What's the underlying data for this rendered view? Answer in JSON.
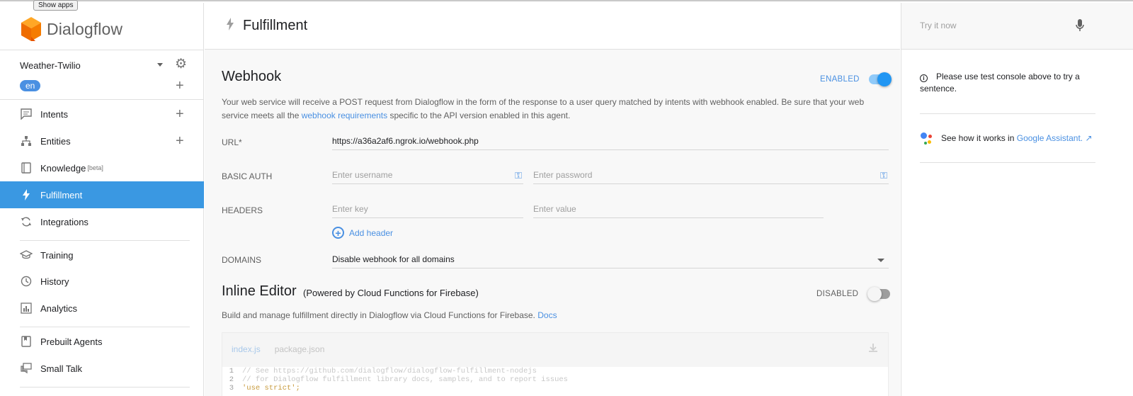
{
  "tooltip": "Show apps",
  "app": {
    "brand": "Dialogflow"
  },
  "agent": {
    "name": "Weather-Twilio",
    "language": "en"
  },
  "nav": [
    {
      "label": "Intents",
      "icon": "chat-icon"
    },
    {
      "label": "Entities",
      "icon": "hierarchy-icon"
    },
    {
      "label": "Knowledge",
      "badge": "[beta]",
      "icon": "book-icon"
    },
    {
      "label": "Fulfillment",
      "icon": "bolt-icon"
    },
    {
      "label": "Integrations",
      "icon": "sync-icon"
    },
    {
      "label": "Training",
      "icon": "graduation-cap-icon"
    },
    {
      "label": "History",
      "icon": "clock-icon"
    },
    {
      "label": "Analytics",
      "icon": "bar-chart-icon"
    },
    {
      "label": "Prebuilt Agents",
      "icon": "bookmark-book-icon"
    },
    {
      "label": "Small Talk",
      "icon": "speech-bubbles-icon"
    }
  ],
  "page": {
    "title": "Fulfillment"
  },
  "webhook": {
    "title": "Webhook",
    "status": "ENABLED",
    "enabled": true,
    "description_pre": "Your web service will receive a POST request from Dialogflow in the form of the response to a user query matched by intents with webhook enabled. Be sure that your web service meets all the ",
    "description_link": "webhook requirements",
    "description_post": " specific to the API version enabled in this agent.",
    "url_label": "URL*",
    "url_value": "https://a36a2af6.ngrok.io/webhook.php",
    "basic_auth_label": "BASIC AUTH",
    "username_placeholder": "Enter username",
    "password_placeholder": "Enter password",
    "headers_label": "HEADERS",
    "key_placeholder": "Enter key",
    "value_placeholder": "Enter value",
    "add_header": "Add header",
    "domains_label": "DOMAINS",
    "domains_value": "Disable webhook for all domains"
  },
  "inline_editor": {
    "title": "Inline Editor",
    "subtitle": "(Powered by Cloud Functions for Firebase)",
    "status": "DISABLED",
    "enabled": false,
    "description": "Build and manage fulfillment directly in Dialogflow via Cloud Functions for Firebase.",
    "docs_link": "Docs",
    "tabs": [
      "index.js",
      "package.json"
    ],
    "code": [
      {
        "num": "1",
        "text": "// See https://github.com/dialogflow/dialogflow-fulfillment-nodejs"
      },
      {
        "num": "2",
        "text": "// for Dialogflow fulfillment library docs, samples, and to report issues"
      },
      {
        "num": "3",
        "text": "'use strict';"
      }
    ]
  },
  "test_console": {
    "placeholder": "Try it now",
    "info": "Please use test console above to try a sentence.",
    "assistant_pre": "See how it works in ",
    "assistant_link": "Google Assistant.",
    "external_icon": "↗"
  },
  "colors": {
    "accent": "#3a98e2",
    "link": "#4a90e2",
    "brand_orange": "#ef6c00"
  }
}
